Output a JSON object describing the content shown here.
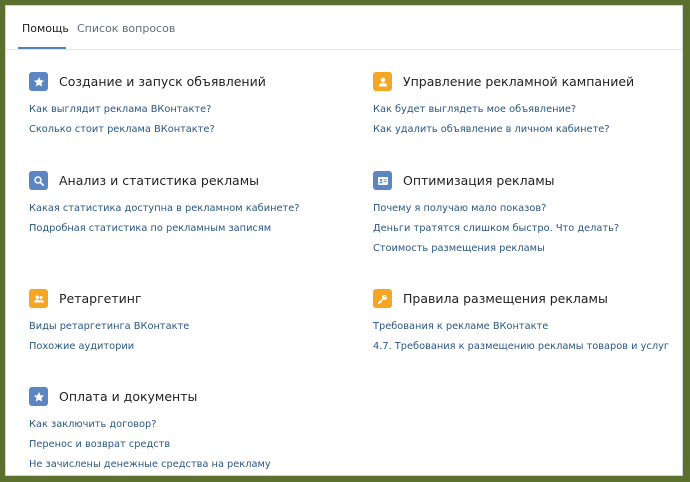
{
  "tabs": [
    {
      "label": "Помощь"
    },
    {
      "label": "Список вопросов"
    }
  ],
  "colors": {
    "blue_icon": "#5b86c2",
    "orange_icon": "#f5a623",
    "link": "#2a5885",
    "tab_underline": "#5181b8"
  },
  "sections": [
    {
      "title": "Создание и запуск объявлений",
      "icon": "star-icon",
      "links": [
        "Как выглядит реклама ВКонтакте?",
        "Сколько стоит реклама ВКонтакте?"
      ]
    },
    {
      "title": "Управление рекламной кампанией",
      "icon": "user-icon",
      "links": [
        "Как будет выглядеть мое объявление?",
        "Как удалить объявление в личном кабинете?"
      ]
    },
    {
      "title": "Анализ и статистика рекламы",
      "icon": "search-icon",
      "links": [
        "Какая статистика доступна в рекламном кабинете?",
        "Подробная статистика по рекламным записям"
      ]
    },
    {
      "title": "Оптимизация рекламы",
      "icon": "profile-card-icon",
      "links": [
        "Почему я получаю мало показов?",
        "Деньги тратятся слишком быстро. Что делать?",
        "Стоимость размещения рекламы"
      ]
    },
    {
      "title": "Ретаргетинг",
      "icon": "users-icon",
      "links": [
        "Виды ретаргетинга ВКонтакте",
        "Похожие аудитории"
      ]
    },
    {
      "title": "Правила размещения рекламы",
      "icon": "key-icon",
      "links": [
        "Требования к рекламе ВКонтакте",
        "4.7. Требования к размещению рекламы товаров и услуг"
      ]
    },
    {
      "title": "Оплата и документы",
      "icon": "star-icon",
      "links": [
        "Как заключить договор?",
        "Перенос и возврат средств",
        "Не зачислены денежные средства на рекламу"
      ]
    }
  ]
}
